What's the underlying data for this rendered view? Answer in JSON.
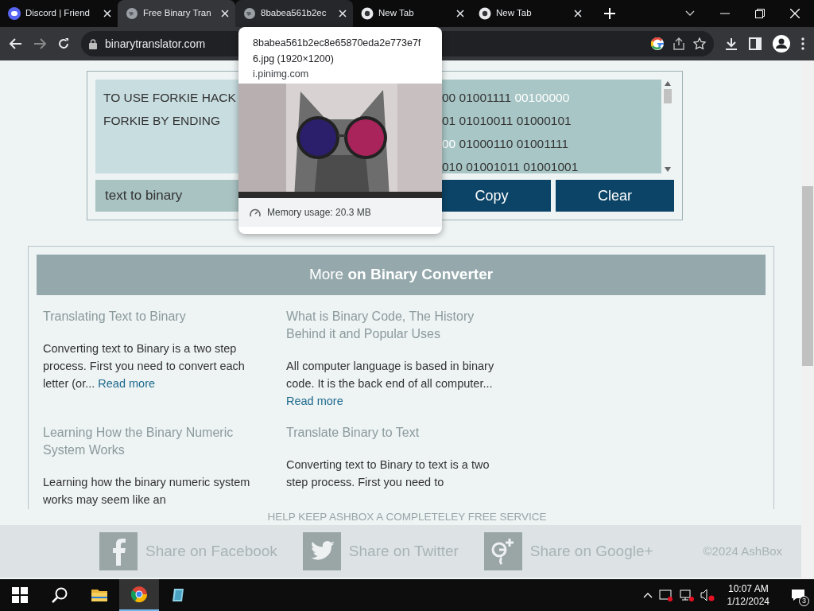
{
  "browser": {
    "tabs": [
      {
        "title": "Discord | Friend",
        "selected": false,
        "hovered": false
      },
      {
        "title": "Free Binary Tran",
        "selected": true,
        "hovered": false
      },
      {
        "title": "8babea561b2ec",
        "selected": false,
        "hovered": true
      },
      {
        "title": "New Tab",
        "selected": false,
        "hovered": false
      },
      {
        "title": "New Tab",
        "selected": false,
        "hovered": false
      }
    ],
    "address": "binarytranslator.com"
  },
  "tab_preview": {
    "title": "8babea561b2ec8e65870eda2e773e7f6.jpg (1920×1200)",
    "host": "i.pinimg.com",
    "memory": "Memory usage: 20.3 MB"
  },
  "translator": {
    "input_lines": [
      "TO USE FORKIE HACK",
      "FORKIE BY ENDING"
    ],
    "output_lines": [
      [
        {
          "text": "00 01001111",
          "highlighted": false
        },
        {
          "text": "00100000",
          "highlighted": true
        }
      ],
      [
        {
          "text": "01 01010011 01000101",
          "highlighted": false
        }
      ],
      [
        {
          "text": "00",
          "highlighted": true
        },
        {
          "text": "01000110 01001111",
          "highlighted": false
        }
      ],
      [
        {
          "text": "010 01001011 01001001",
          "highlighted": false
        }
      ]
    ],
    "mode": "text to binary",
    "buttons": [
      "Copy",
      "Clear"
    ]
  },
  "more": {
    "heading": "More **on Binary Converter**",
    "articles": [
      {
        "title": "Translating Text to Binary",
        "body": "Converting text to Binary is a two step process. First you need to convert each letter (or...",
        "link": "Read more"
      },
      {
        "title": "What is Binary Code, The History Behind it and Popular Uses",
        "body": "All computer language is based in binary code. It is the back end of all computer...",
        "link": "Read more"
      },
      {
        "title": "Learning How the Binary Numeric System Works",
        "body": "Learning how the binary numeric system works may seem like an"
      },
      {
        "title": "Translate Binary to Text",
        "body": "Converting text to Binary to text is a two step process. First you need to"
      }
    ]
  },
  "footer": {
    "notice": "HELP KEEP ASHBOX A COMPLETELEY FREE SERVICE",
    "shares": [
      {
        "label": "Share on Facebook"
      },
      {
        "label": "Share on Twitter"
      },
      {
        "label": "Share on Google+"
      }
    ],
    "copyright": "©2024 AshBox"
  },
  "taskbar": {
    "apps": [
      {
        "kind": "explorer",
        "active": false
      },
      {
        "kind": "chrome",
        "active": true
      },
      {
        "kind": "notes",
        "active": false
      }
    ],
    "time": "10:07 AM",
    "date": "1/12/2024",
    "notifications": "3"
  }
}
